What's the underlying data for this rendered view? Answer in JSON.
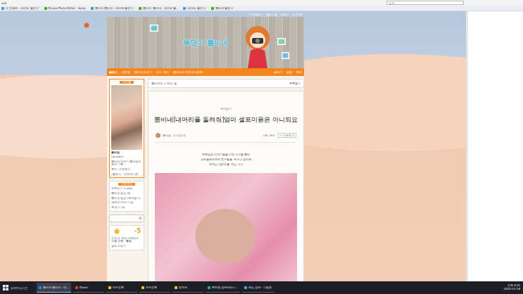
{
  "browser": {
    "address": "ail6",
    "search_placeholder": "검색",
    "bookmarks": [
      "이 오페라 - 네이버 블로그",
      "Picasa Photo Editor - Song",
      "뽐비의 뽐비네 : 네이버 블로그",
      "뽐비의 뽐비네 : 네이버 블..",
      "네이버 블로그",
      "뽐비네 블로그"
    ]
  },
  "blog": {
    "top_links": [
      "이웃블로그",
      "블로그홈",
      "내메뉴",
      "로그아웃"
    ],
    "title": "똑덩이 뽐비네",
    "nav": [
      {
        "label": "블로그",
        "selected": true
      },
      {
        "label": "메모장",
        "selected": false
      },
      {
        "label": "뽐비네 이야기",
        "selected": false
      },
      {
        "label": "태그 추가",
        "selected": false
      },
      {
        "label": "뽐비네의 안부게시판(5)",
        "selected": false
      }
    ],
    "nav_right": [
      "글쓰기",
      "설정",
      "통계"
    ]
  },
  "profile": {
    "tab": "프로필",
    "name": "뽐비엄",
    "id": "(ohsudoc)",
    "intro": "뽐비네 이야기 뽐비엄의 육아 기록",
    "links": "쪽지 · 이웃추가",
    "extra": "♪블로그 · 안부게시판"
  },
  "category": {
    "title": "카테고리",
    "items": [
      "전체보기 (1,494)",
      "뽐비네 일상 (8)",
      "뽐비네 일상 (육아일기)",
      "재태크 이야기 (4)",
      "책 읽기 (4)"
    ]
  },
  "weather": {
    "temp": "-5",
    "desc": "오전 눈 예보 미세먼지 서울 보통 / 좋음",
    "more": "날씨 더보기"
  },
  "content": {
    "list_title": "뽐비네의 그 외의 글",
    "list_toggle": "목록열기",
    "category": "육아일기",
    "title": "뽐비네[내머리를 돌려줘]엄마 셀프미용은 아니되요",
    "author": "뽐비엄",
    "time": "11시간 전",
    "url_copy": "URL 복사",
    "follow": "+ 이웃추가",
    "body": [
      "독백같은 이야기들을 가진 그녀들 뽐비",
      "우리들에서부터 친구들을 찍거나 엄마께",
      "하하는 [엄마] 를 하는 그녀"
    ]
  },
  "taskbar": {
    "search": "입력하십시오",
    "items": [
      {
        "label": "뽐비의 뽐비네 : 네...",
        "selected": true,
        "color": "#1e88e5"
      },
      {
        "label": "Daum",
        "selected": false,
        "color": "#e53935"
      },
      {
        "label": "카카오톡",
        "selected": false,
        "color": "#fbc02d"
      },
      {
        "label": "카카오톡",
        "selected": false,
        "color": "#fbc02d"
      },
      {
        "label": "한국어",
        "selected": false,
        "color": "#fbc02d"
      },
      {
        "label": "특허청 검색서비스...",
        "selected": false,
        "color": "#26a69a"
      },
      {
        "label": "메뉴 검색 - 그림판",
        "selected": false,
        "color": "#42a5f5"
      }
    ],
    "time": "오후 4:01",
    "date": "2020-12-18"
  }
}
